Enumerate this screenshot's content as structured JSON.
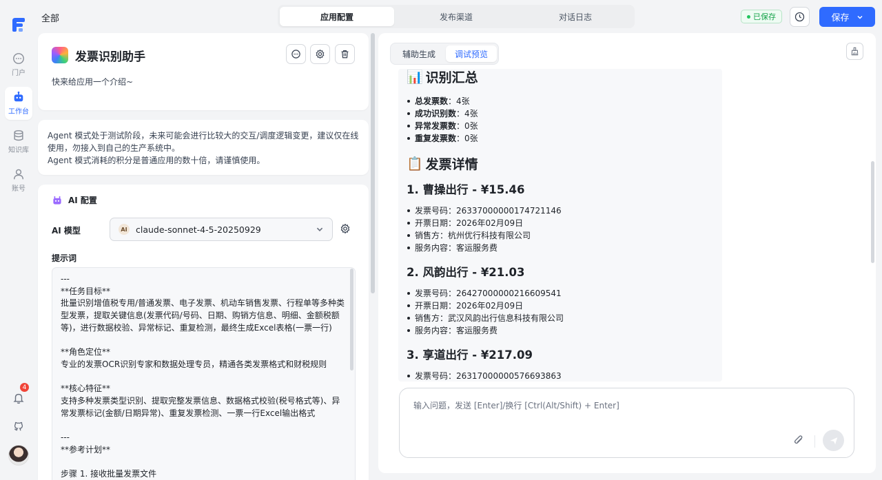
{
  "nav": {
    "items": [
      {
        "label": "门户",
        "icon": "chat-bubble-icon"
      },
      {
        "label": "工作台",
        "icon": "robot-icon"
      },
      {
        "label": "知识库",
        "icon": "database-icon"
      },
      {
        "label": "账号",
        "icon": "user-icon"
      }
    ],
    "notification_count": "4"
  },
  "header": {
    "breadcrumb": "全部",
    "tabs": [
      {
        "label": "应用配置"
      },
      {
        "label": "发布渠道"
      },
      {
        "label": "对话日志"
      }
    ],
    "saved_label": "已保存",
    "save_label": "保存"
  },
  "app": {
    "title": "发票识别助手",
    "intro": "快来给应用一个介绍~"
  },
  "notice": {
    "line1": "Agent 模式处于测试阶段，未来可能会进行比较大的交互/调度逻辑变更，建议仅在线使用，勿接入到自己的生产系统中。",
    "line2": "Agent 模式消耗的积分是普通应用的数十倍，请谨慎使用。"
  },
  "ai_config": {
    "title": "AI 配置",
    "model_label": "AI 模型",
    "model_value": "claude-sonnet-4-5-20250929",
    "model_provider_badge": "AI",
    "prompt_label": "提示词",
    "prompt_text": "---\n**任务目标**\n批量识别增值税专用/普通发票、电子发票、机动车销售发票、行程单等多种类型发票，提取关键信息(发票代码/号码、日期、购销方信息、明细、金额税额等)，进行数据校验、异常标记、重复检测，最终生成Excel表格(一票一行)\n\n**角色定位**\n专业的发票OCR识别专家和数据处理专员，精通各类发票格式和财税规则\n\n**核心特征**\n支持多种发票类型识别、提取完整发票信息、数据格式校验(税号格式等)、异常发票标记(金额/日期异常)、重复发票检测、一票一行Excel输出格式\n\n---\n**参考计划**\n\n步骤 1. 接收批量发票文件"
  },
  "preview": {
    "tabs": [
      {
        "label": "辅助生成"
      },
      {
        "label": "调试预览"
      }
    ],
    "summary_heading": "识别汇总",
    "summary_emoji": "📊",
    "summary": [
      {
        "key": "总发票数",
        "value": "4张"
      },
      {
        "key": "成功识别数",
        "value": "4张"
      },
      {
        "key": "异常发票数",
        "value": "0张"
      },
      {
        "key": "重复发票数",
        "value": "0张"
      }
    ],
    "detail_heading": "发票详情",
    "detail_emoji": "📋",
    "invoices": [
      {
        "title": "1. 曹操出行 - ¥15.46",
        "lines": [
          "发票号码：26337000000174721146",
          "开票日期：2026年02月09日",
          "销售方：杭州优行科技有限公司",
          "服务内容：客运服务费"
        ]
      },
      {
        "title": "2. 风韵出行 - ¥21.03",
        "lines": [
          "发票号码：26427000000216609541",
          "开票日期：2026年02月09日",
          "销售方：武汉风韵出行信息科技有限公司",
          "服务内容：客运服务费"
        ]
      },
      {
        "title": "3. 享道出行 - ¥217.09",
        "lines": [
          "发票号码：26317000000576693863"
        ]
      }
    ],
    "input_placeholder": "输入问题，发送 [Enter]/换行 [Ctrl(Alt/Shift) + Enter]"
  },
  "colors": {
    "accent": "#2f6bff",
    "saved_green": "#16a34a",
    "badge_red": "#f04438"
  }
}
